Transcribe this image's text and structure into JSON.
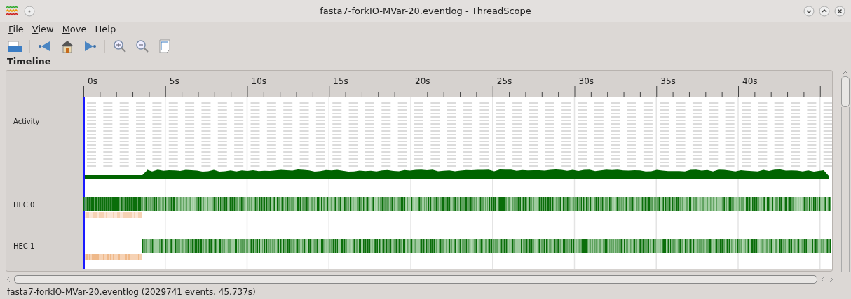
{
  "window": {
    "title": "fasta7-forkIO-MVar-20.eventlog - ThreadScope"
  },
  "menu": [
    {
      "label": "File",
      "underlined_first": true
    },
    {
      "label": "View",
      "underlined_first": true
    },
    {
      "label": "Move",
      "underlined_first": true
    },
    {
      "label": "Help",
      "underlined_first": false
    }
  ],
  "section_title": "Timeline",
  "timeline": {
    "ticks": [
      "0s",
      "5s",
      "10s",
      "15s",
      "20s",
      "25s",
      "30s",
      "35s",
      "40s"
    ],
    "tracks": [
      {
        "label": "Activity",
        "kind": "activity"
      },
      {
        "label": "HEC 0",
        "kind": "hec",
        "delayed_start": false
      },
      {
        "label": "HEC 1",
        "kind": "hec",
        "delayed_start": true
      }
    ]
  },
  "status_bar": "fasta7-forkIO-MVar-20.eventlog (2029741 events, 45.737s)"
}
